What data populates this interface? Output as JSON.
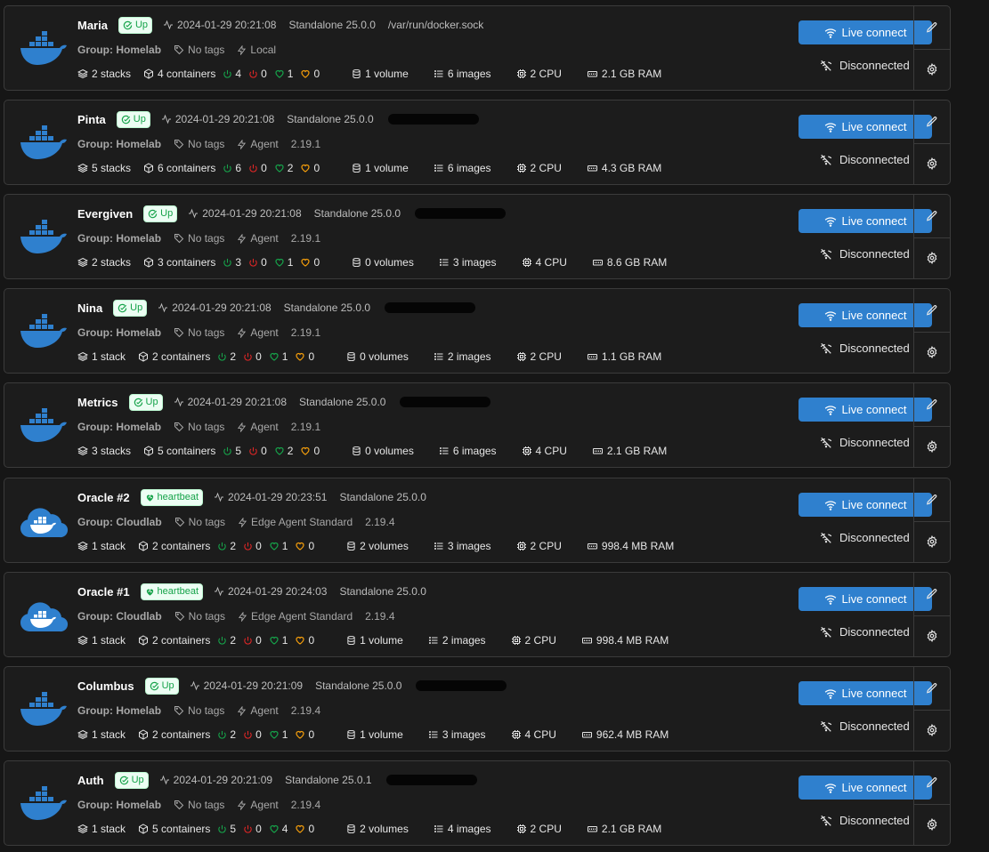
{
  "colors": {
    "background": "#161616",
    "card": "#1c1c1c",
    "border": "#3b3b3b",
    "accent": "#2f80ce",
    "up_green": "#16a34a",
    "stopped_red": "#dc2626",
    "unhealthy_orange": "#f59e0b"
  },
  "labels": {
    "live_connect": "Live connect",
    "disconnected": "Disconnected",
    "group_prefix": "Group:"
  },
  "environments": [
    {
      "name": "Maria",
      "status": "Up",
      "status_type": "up",
      "timestamp": "2024-01-29 20:21:08",
      "type": "Standalone 25.0.0",
      "url": "/var/run/docker.sock",
      "redacted": false,
      "group": "Homelab",
      "tags": "No tags",
      "agent": "Local",
      "agent_version": "",
      "logo": "docker",
      "stacks": "2 stacks",
      "containers": "4 containers",
      "running": "4",
      "stopped": "0",
      "healthy": "1",
      "unhealthy": "0",
      "volumes": "1 volume",
      "images": "6 images",
      "cpu": "2 CPU",
      "ram": "2.1 GB RAM"
    },
    {
      "name": "Pinta",
      "status": "Up",
      "status_type": "up",
      "timestamp": "2024-01-29 20:21:08",
      "type": "Standalone 25.0.0",
      "url": "",
      "redacted": true,
      "group": "Homelab",
      "tags": "No tags",
      "agent": "Agent",
      "agent_version": "2.19.1",
      "logo": "docker",
      "stacks": "5 stacks",
      "containers": "6 containers",
      "running": "6",
      "stopped": "0",
      "healthy": "2",
      "unhealthy": "0",
      "volumes": "1 volume",
      "images": "6 images",
      "cpu": "2 CPU",
      "ram": "4.3 GB RAM"
    },
    {
      "name": "Evergiven",
      "status": "Up",
      "status_type": "up",
      "timestamp": "2024-01-29 20:21:08",
      "type": "Standalone 25.0.0",
      "url": "",
      "redacted": true,
      "group": "Homelab",
      "tags": "No tags",
      "agent": "Agent",
      "agent_version": "2.19.1",
      "logo": "docker",
      "stacks": "2 stacks",
      "containers": "3 containers",
      "running": "3",
      "stopped": "0",
      "healthy": "1",
      "unhealthy": "0",
      "volumes": "0 volumes",
      "images": "3 images",
      "cpu": "4 CPU",
      "ram": "8.6 GB RAM"
    },
    {
      "name": "Nina",
      "status": "Up",
      "status_type": "up",
      "timestamp": "2024-01-29 20:21:08",
      "type": "Standalone 25.0.0",
      "url": "",
      "redacted": true,
      "group": "Homelab",
      "tags": "No tags",
      "agent": "Agent",
      "agent_version": "2.19.1",
      "logo": "docker",
      "stacks": "1 stack",
      "containers": "2 containers",
      "running": "2",
      "stopped": "0",
      "healthy": "1",
      "unhealthy": "0",
      "volumes": "0 volumes",
      "images": "2 images",
      "cpu": "2 CPU",
      "ram": "1.1 GB RAM"
    },
    {
      "name": "Metrics",
      "status": "Up",
      "status_type": "up",
      "timestamp": "2024-01-29 20:21:08",
      "type": "Standalone 25.0.0",
      "url": "",
      "redacted": true,
      "group": "Homelab",
      "tags": "No tags",
      "agent": "Agent",
      "agent_version": "2.19.1",
      "logo": "docker",
      "stacks": "3 stacks",
      "containers": "5 containers",
      "running": "5",
      "stopped": "0",
      "healthy": "2",
      "unhealthy": "0",
      "volumes": "0 volumes",
      "images": "6 images",
      "cpu": "4 CPU",
      "ram": "2.1 GB RAM"
    },
    {
      "name": "Oracle #2",
      "status": "heartbeat",
      "status_type": "heartbeat",
      "timestamp": "2024-01-29 20:23:51",
      "type": "Standalone 25.0.0",
      "url": "",
      "redacted": false,
      "group": "Cloudlab",
      "tags": "No tags",
      "agent": "Edge Agent Standard",
      "agent_version": "2.19.4",
      "logo": "cloud",
      "stacks": "1 stack",
      "containers": "2 containers",
      "running": "2",
      "stopped": "0",
      "healthy": "1",
      "unhealthy": "0",
      "volumes": "2 volumes",
      "images": "3 images",
      "cpu": "2 CPU",
      "ram": "998.4 MB RAM"
    },
    {
      "name": "Oracle #1",
      "status": "heartbeat",
      "status_type": "heartbeat",
      "timestamp": "2024-01-29 20:24:03",
      "type": "Standalone 25.0.0",
      "url": "",
      "redacted": false,
      "group": "Cloudlab",
      "tags": "No tags",
      "agent": "Edge Agent Standard",
      "agent_version": "2.19.4",
      "logo": "cloud",
      "stacks": "1 stack",
      "containers": "2 containers",
      "running": "2",
      "stopped": "0",
      "healthy": "1",
      "unhealthy": "0",
      "volumes": "1 volume",
      "images": "2 images",
      "cpu": "2 CPU",
      "ram": "998.4 MB RAM"
    },
    {
      "name": "Columbus",
      "status": "Up",
      "status_type": "up",
      "timestamp": "2024-01-29 20:21:09",
      "type": "Standalone 25.0.0",
      "url": "",
      "redacted": true,
      "group": "Homelab",
      "tags": "No tags",
      "agent": "Agent",
      "agent_version": "2.19.4",
      "logo": "docker",
      "stacks": "1 stack",
      "containers": "2 containers",
      "running": "2",
      "stopped": "0",
      "healthy": "1",
      "unhealthy": "0",
      "volumes": "1 volume",
      "images": "3 images",
      "cpu": "4 CPU",
      "ram": "962.4 MB RAM"
    },
    {
      "name": "Auth",
      "status": "Up",
      "status_type": "up",
      "timestamp": "2024-01-29 20:21:09",
      "type": "Standalone 25.0.1",
      "url": "",
      "redacted": true,
      "group": "Homelab",
      "tags": "No tags",
      "agent": "Agent",
      "agent_version": "2.19.4",
      "logo": "docker",
      "stacks": "1 stack",
      "containers": "5 containers",
      "running": "5",
      "stopped": "0",
      "healthy": "4",
      "unhealthy": "0",
      "volumes": "2 volumes",
      "images": "4 images",
      "cpu": "2 CPU",
      "ram": "2.1 GB RAM"
    }
  ]
}
